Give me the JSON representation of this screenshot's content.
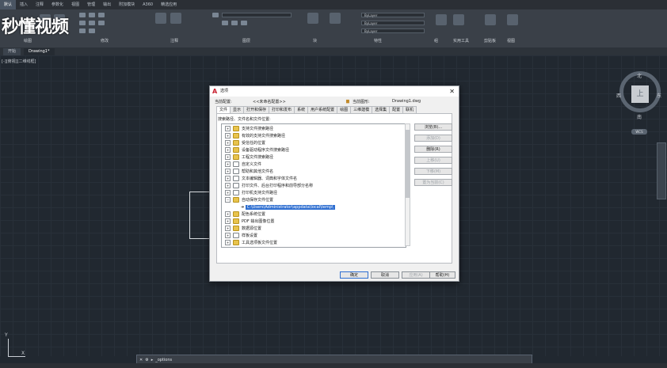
{
  "ribbon": {
    "tabs": [
      "默认",
      "插入",
      "注释",
      "参数化",
      "视图",
      "管理",
      "输出",
      "附加模块",
      "A360",
      "精选应用"
    ],
    "panels": [
      "绘图",
      "修改",
      "注释",
      "图层",
      "块",
      "特性",
      "组",
      "实用工具",
      "剪贴板",
      "视图"
    ],
    "layer_fields": [
      "ByLayer",
      "ByLayer",
      "ByLayer"
    ],
    "watermark": "秒懂视频"
  },
  "doc_tabs": [
    "开始",
    "Drawing1*"
  ],
  "canvas": {
    "view_label": "[-][俯视][二维线框]",
    "compass": {
      "north": "北",
      "south": "南",
      "east": "东",
      "west": "西",
      "top": "上"
    },
    "wcs": "WCS",
    "ucs_y": "Y",
    "ucs_x": "X"
  },
  "command_line": {
    "prompt": "_options"
  },
  "dialog": {
    "title": "选项",
    "current_profile_label": "当前配置:",
    "current_profile_value": "<<未命名配置>>",
    "current_drawing_label": "当前图形:",
    "current_drawing_value": "Drawing1.dwg",
    "tabs": [
      "文件",
      "显示",
      "打开和保存",
      "打印和发布",
      "系统",
      "用户系统配置",
      "绘图",
      "三维建模",
      "选择集",
      "配置",
      "联机"
    ],
    "section_label": "搜索路径、文件名和文件位置:",
    "tree": [
      {
        "label": "支持文件搜索路径",
        "icon": "folder"
      },
      {
        "label": "有效的支持文件搜索路径",
        "icon": "folder"
      },
      {
        "label": "受信任的位置",
        "icon": "folder"
      },
      {
        "label": "设备驱动程序文件搜索路径",
        "icon": "folder"
      },
      {
        "label": "工程文件搜索路径",
        "icon": "folder"
      },
      {
        "label": "自定义文件",
        "icon": "file"
      },
      {
        "label": "帮助和其他文件名",
        "icon": "file"
      },
      {
        "label": "文本编辑器、词典和字体文件名",
        "icon": "file"
      },
      {
        "label": "打印文件、后台打印程序和前导部分名称",
        "icon": "file"
      },
      {
        "label": "打印机支持文件路径",
        "icon": "file"
      },
      {
        "label": "自动保存文件位置",
        "icon": "folder"
      },
      {
        "label": "C:\\Users\\Administrator\\appdata\\local\\temp\\",
        "icon": "arrow"
      },
      {
        "label": "配色系统位置",
        "icon": "folder"
      },
      {
        "label": "PDF 输出图像位置",
        "icon": "folder"
      },
      {
        "label": "数据源位置",
        "icon": "folder"
      },
      {
        "label": "样板设置",
        "icon": "file"
      },
      {
        "label": "工具选项板文件位置",
        "icon": "folder"
      }
    ],
    "side_buttons": [
      {
        "label": "浏览(B)...",
        "enabled": true
      },
      {
        "label": "添加(D)",
        "enabled": false
      },
      {
        "label": "删除(R)",
        "enabled": true
      },
      {
        "label": "上移(U)",
        "enabled": false
      },
      {
        "label": "下移(M)",
        "enabled": false
      },
      {
        "label": "置为当前(C)",
        "enabled": false
      }
    ],
    "footer_buttons": {
      "ok": "确定",
      "cancel": "取消",
      "apply": "应用(A)",
      "help": "帮助(H)"
    }
  }
}
